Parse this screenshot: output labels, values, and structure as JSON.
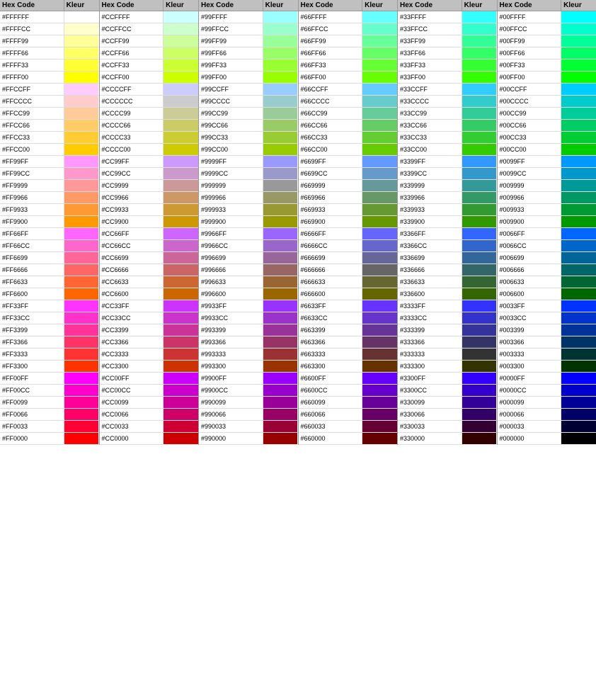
{
  "columns": [
    {
      "id": "col1",
      "header": {
        "hex": "Hex Code",
        "kleur": "Kleur"
      },
      "rows": [
        {
          "hex": "#FFFFFF",
          "color": "#FFFFFF"
        },
        {
          "hex": "#FFFFCC",
          "color": "#FFFFCC"
        },
        {
          "hex": "#FFFF99",
          "color": "#FFFF99"
        },
        {
          "hex": "#FFFF66",
          "color": "#FFFF66"
        },
        {
          "hex": "#FFFF33",
          "color": "#FFFF33"
        },
        {
          "hex": "#FFFF00",
          "color": "#FFFF00"
        },
        {
          "hex": "#FFCCFF",
          "color": "#FFCCFF"
        },
        {
          "hex": "#FFCCCC",
          "color": "#FFCCCC"
        },
        {
          "hex": "#FFCC99",
          "color": "#FFCC99"
        },
        {
          "hex": "#FFCC66",
          "color": "#FFCC66"
        },
        {
          "hex": "#FFCC33",
          "color": "#FFCC33"
        },
        {
          "hex": "#FFCC00",
          "color": "#FFCC00"
        },
        {
          "hex": "#FF99FF",
          "color": "#FF99FF"
        },
        {
          "hex": "#FF99CC",
          "color": "#FF99CC"
        },
        {
          "hex": "#FF9999",
          "color": "#FF9999"
        },
        {
          "hex": "#FF9966",
          "color": "#FF9966"
        },
        {
          "hex": "#FF9933",
          "color": "#FF9933"
        },
        {
          "hex": "#FF9900",
          "color": "#FF9900"
        },
        {
          "hex": "#FF66FF",
          "color": "#FF66FF"
        },
        {
          "hex": "#FF66CC",
          "color": "#FF66CC"
        },
        {
          "hex": "#FF6699",
          "color": "#FF6699"
        },
        {
          "hex": "#FF6666",
          "color": "#FF6666"
        },
        {
          "hex": "#FF6633",
          "color": "#FF6633"
        },
        {
          "hex": "#FF6600",
          "color": "#FF6600"
        },
        {
          "hex": "#FF33FF",
          "color": "#FF33FF"
        },
        {
          "hex": "#FF33CC",
          "color": "#FF33CC"
        },
        {
          "hex": "#FF3399",
          "color": "#FF3399"
        },
        {
          "hex": "#FF3366",
          "color": "#FF3366"
        },
        {
          "hex": "#FF3333",
          "color": "#FF3333"
        },
        {
          "hex": "#FF3300",
          "color": "#FF3300"
        },
        {
          "hex": "#FF00FF",
          "color": "#FF00FF"
        },
        {
          "hex": "#FF00CC",
          "color": "#FF00CC"
        },
        {
          "hex": "#FF0099",
          "color": "#FF0099"
        },
        {
          "hex": "#FF0066",
          "color": "#FF0066"
        },
        {
          "hex": "#FF0033",
          "color": "#FF0033"
        },
        {
          "hex": "#FF0000",
          "color": "#FF0000"
        }
      ]
    },
    {
      "id": "col2",
      "header": {
        "hex": "Hex Code",
        "kleur": "Kleur"
      },
      "rows": [
        {
          "hex": "#CCFFFF",
          "color": "#CCFFFF"
        },
        {
          "hex": "#CCFFCC",
          "color": "#CCFFCC"
        },
        {
          "hex": "#CCFF99",
          "color": "#CCFF99"
        },
        {
          "hex": "#CCFF66",
          "color": "#CCFF66"
        },
        {
          "hex": "#CCFF33",
          "color": "#CCFF33"
        },
        {
          "hex": "#CCFF00",
          "color": "#CCFF00"
        },
        {
          "hex": "#CCCCFF",
          "color": "#CCCCFF"
        },
        {
          "hex": "#CCCCCC",
          "color": "#CCCCCC"
        },
        {
          "hex": "#CCCC99",
          "color": "#CCCC99"
        },
        {
          "hex": "#CCCC66",
          "color": "#CCCC66"
        },
        {
          "hex": "#CCCC33",
          "color": "#CCCC33"
        },
        {
          "hex": "#CCCC00",
          "color": "#CCCC00"
        },
        {
          "hex": "#CC99FF",
          "color": "#CC99FF"
        },
        {
          "hex": "#CC99CC",
          "color": "#CC99CC"
        },
        {
          "hex": "#CC9999",
          "color": "#CC9999"
        },
        {
          "hex": "#CC9966",
          "color": "#CC9966"
        },
        {
          "hex": "#CC9933",
          "color": "#CC9933"
        },
        {
          "hex": "#CC9900",
          "color": "#CC9900"
        },
        {
          "hex": "#CC66FF",
          "color": "#CC66FF"
        },
        {
          "hex": "#CC66CC",
          "color": "#CC66CC"
        },
        {
          "hex": "#CC6699",
          "color": "#CC6699"
        },
        {
          "hex": "#CC6666",
          "color": "#CC6666"
        },
        {
          "hex": "#CC6633",
          "color": "#CC6633"
        },
        {
          "hex": "#CC6600",
          "color": "#CC6600"
        },
        {
          "hex": "#CC33FF",
          "color": "#CC33FF"
        },
        {
          "hex": "#CC33CC",
          "color": "#CC33CC"
        },
        {
          "hex": "#CC3399",
          "color": "#CC3399"
        },
        {
          "hex": "#CC3366",
          "color": "#CC3366"
        },
        {
          "hex": "#CC3333",
          "color": "#CC3333"
        },
        {
          "hex": "#CC3300",
          "color": "#CC3300"
        },
        {
          "hex": "#CC00FF",
          "color": "#CC00FF"
        },
        {
          "hex": "#CC00CC",
          "color": "#CC00CC"
        },
        {
          "hex": "#CC0099",
          "color": "#CC0099"
        },
        {
          "hex": "#CC0066",
          "color": "#CC0066"
        },
        {
          "hex": "#CC0033",
          "color": "#CC0033"
        },
        {
          "hex": "#CC0000",
          "color": "#CC0000"
        }
      ]
    },
    {
      "id": "col3",
      "header": {
        "hex": "Hex Code",
        "kleur": "Kleur"
      },
      "rows": [
        {
          "hex": "#99FFFF",
          "color": "#99FFFF"
        },
        {
          "hex": "#99FFCC",
          "color": "#99FFCC"
        },
        {
          "hex": "#99FF99",
          "color": "#99FF99"
        },
        {
          "hex": "#99FF66",
          "color": "#99FF66"
        },
        {
          "hex": "#99FF33",
          "color": "#99FF33"
        },
        {
          "hex": "#99FF00",
          "color": "#99FF00"
        },
        {
          "hex": "#99CCFF",
          "color": "#99CCFF"
        },
        {
          "hex": "#99CCCC",
          "color": "#99CCCC"
        },
        {
          "hex": "#99CC99",
          "color": "#99CC99"
        },
        {
          "hex": "#99CC66",
          "color": "#99CC66"
        },
        {
          "hex": "#99CC33",
          "color": "#99CC33"
        },
        {
          "hex": "#99CC00",
          "color": "#99CC00"
        },
        {
          "hex": "#9999FF",
          "color": "#9999FF"
        },
        {
          "hex": "#9999CC",
          "color": "#9999CC"
        },
        {
          "hex": "#999999",
          "color": "#999999"
        },
        {
          "hex": "#999966",
          "color": "#999966"
        },
        {
          "hex": "#999933",
          "color": "#999933"
        },
        {
          "hex": "#999900",
          "color": "#999900"
        },
        {
          "hex": "#9966FF",
          "color": "#9966FF"
        },
        {
          "hex": "#9966CC",
          "color": "#9966CC"
        },
        {
          "hex": "#996699",
          "color": "#996699"
        },
        {
          "hex": "#996666",
          "color": "#996666"
        },
        {
          "hex": "#996633",
          "color": "#996633"
        },
        {
          "hex": "#996600",
          "color": "#996600"
        },
        {
          "hex": "#9933FF",
          "color": "#9933FF"
        },
        {
          "hex": "#9933CC",
          "color": "#9933CC"
        },
        {
          "hex": "#993399",
          "color": "#993399"
        },
        {
          "hex": "#993366",
          "color": "#993366"
        },
        {
          "hex": "#993333",
          "color": "#993333"
        },
        {
          "hex": "#993300",
          "color": "#993300"
        },
        {
          "hex": "#9900FF",
          "color": "#9900FF"
        },
        {
          "hex": "#9900CC",
          "color": "#9900CC"
        },
        {
          "hex": "#990099",
          "color": "#990099"
        },
        {
          "hex": "#990066",
          "color": "#990066"
        },
        {
          "hex": "#990033",
          "color": "#990033"
        },
        {
          "hex": "#990000",
          "color": "#990000"
        }
      ]
    },
    {
      "id": "col4",
      "header": {
        "hex": "Hex Code",
        "kleur": "Kleur"
      },
      "rows": [
        {
          "hex": "#66FFFF",
          "color": "#66FFFF"
        },
        {
          "hex": "#66FFCC",
          "color": "#66FFCC"
        },
        {
          "hex": "#66FF99",
          "color": "#66FF99"
        },
        {
          "hex": "#66FF66",
          "color": "#66FF66"
        },
        {
          "hex": "#66FF33",
          "color": "#66FF33"
        },
        {
          "hex": "#66FF00",
          "color": "#66FF00"
        },
        {
          "hex": "#66CCFF",
          "color": "#66CCFF"
        },
        {
          "hex": "#66CCCC",
          "color": "#66CCCC"
        },
        {
          "hex": "#66CC99",
          "color": "#66CC99"
        },
        {
          "hex": "#66CC66",
          "color": "#66CC66"
        },
        {
          "hex": "#66CC33",
          "color": "#66CC33"
        },
        {
          "hex": "#66CC00",
          "color": "#66CC00"
        },
        {
          "hex": "#6699FF",
          "color": "#6699FF"
        },
        {
          "hex": "#6699CC",
          "color": "#6699CC"
        },
        {
          "hex": "#669999",
          "color": "#669999"
        },
        {
          "hex": "#669966",
          "color": "#669966"
        },
        {
          "hex": "#669933",
          "color": "#669933"
        },
        {
          "hex": "#669900",
          "color": "#669900"
        },
        {
          "hex": "#6666FF",
          "color": "#6666FF"
        },
        {
          "hex": "#6666CC",
          "color": "#6666CC"
        },
        {
          "hex": "#666699",
          "color": "#666699"
        },
        {
          "hex": "#666666",
          "color": "#666666"
        },
        {
          "hex": "#666633",
          "color": "#666633"
        },
        {
          "hex": "#666600",
          "color": "#666600"
        },
        {
          "hex": "#6633FF",
          "color": "#6633FF"
        },
        {
          "hex": "#6633CC",
          "color": "#6633CC"
        },
        {
          "hex": "#663399",
          "color": "#663399"
        },
        {
          "hex": "#663366",
          "color": "#663366"
        },
        {
          "hex": "#663333",
          "color": "#663333"
        },
        {
          "hex": "#663300",
          "color": "#663300"
        },
        {
          "hex": "#6600FF",
          "color": "#6600FF"
        },
        {
          "hex": "#6600CC",
          "color": "#6600CC"
        },
        {
          "hex": "#660099",
          "color": "#660099"
        },
        {
          "hex": "#660066",
          "color": "#660066"
        },
        {
          "hex": "#660033",
          "color": "#660033"
        },
        {
          "hex": "#660000",
          "color": "#660000"
        }
      ]
    },
    {
      "id": "col5",
      "header": {
        "hex": "Hex Code",
        "kleur": "Kleur"
      },
      "rows": [
        {
          "hex": "#33FFFF",
          "color": "#33FFFF"
        },
        {
          "hex": "#33FFCC",
          "color": "#33FFCC"
        },
        {
          "hex": "#33FF99",
          "color": "#33FF99"
        },
        {
          "hex": "#33FF66",
          "color": "#33FF66"
        },
        {
          "hex": "#33FF33",
          "color": "#33FF33"
        },
        {
          "hex": "#33FF00",
          "color": "#33FF00"
        },
        {
          "hex": "#33CCFF",
          "color": "#33CCFF"
        },
        {
          "hex": "#33CCCC",
          "color": "#33CCCC"
        },
        {
          "hex": "#33CC99",
          "color": "#33CC99"
        },
        {
          "hex": "#33CC66",
          "color": "#33CC66"
        },
        {
          "hex": "#33CC33",
          "color": "#33CC33"
        },
        {
          "hex": "#33CC00",
          "color": "#33CC00"
        },
        {
          "hex": "#3399FF",
          "color": "#3399FF"
        },
        {
          "hex": "#3399CC",
          "color": "#3399CC"
        },
        {
          "hex": "#339999",
          "color": "#339999"
        },
        {
          "hex": "#339966",
          "color": "#339966"
        },
        {
          "hex": "#339933",
          "color": "#339933"
        },
        {
          "hex": "#339900",
          "color": "#339900"
        },
        {
          "hex": "#3366FF",
          "color": "#3366FF"
        },
        {
          "hex": "#3366CC",
          "color": "#3366CC"
        },
        {
          "hex": "#336699",
          "color": "#336699"
        },
        {
          "hex": "#336666",
          "color": "#336666"
        },
        {
          "hex": "#336633",
          "color": "#336633"
        },
        {
          "hex": "#336600",
          "color": "#336600"
        },
        {
          "hex": "#3333FF",
          "color": "#3333FF"
        },
        {
          "hex": "#3333CC",
          "color": "#3333CC"
        },
        {
          "hex": "#333399",
          "color": "#333399"
        },
        {
          "hex": "#333366",
          "color": "#333366"
        },
        {
          "hex": "#333333",
          "color": "#333333"
        },
        {
          "hex": "#333300",
          "color": "#333300"
        },
        {
          "hex": "#3300FF",
          "color": "#3300FF"
        },
        {
          "hex": "#3300CC",
          "color": "#3300CC"
        },
        {
          "hex": "#330099",
          "color": "#330099"
        },
        {
          "hex": "#330066",
          "color": "#330066"
        },
        {
          "hex": "#330033",
          "color": "#330033"
        },
        {
          "hex": "#330000",
          "color": "#330000"
        }
      ]
    },
    {
      "id": "col6",
      "header": {
        "hex": "Hex Code",
        "kleur": "Kleur"
      },
      "rows": [
        {
          "hex": "#00FFFF",
          "color": "#00FFFF"
        },
        {
          "hex": "#00FFCC",
          "color": "#00FFCC"
        },
        {
          "hex": "#00FF99",
          "color": "#00FF99"
        },
        {
          "hex": "#00FF66",
          "color": "#00FF66"
        },
        {
          "hex": "#00FF33",
          "color": "#00FF33"
        },
        {
          "hex": "#00FF00",
          "color": "#00FF00"
        },
        {
          "hex": "#00CCFF",
          "color": "#00CCFF"
        },
        {
          "hex": "#00CCCC",
          "color": "#00CCCC"
        },
        {
          "hex": "#00CC99",
          "color": "#00CC99"
        },
        {
          "hex": "#00CC66",
          "color": "#00CC66"
        },
        {
          "hex": "#00CC33",
          "color": "#00CC33"
        },
        {
          "hex": "#00CC00",
          "color": "#00CC00"
        },
        {
          "hex": "#0099FF",
          "color": "#0099FF"
        },
        {
          "hex": "#0099CC",
          "color": "#0099CC"
        },
        {
          "hex": "#009999",
          "color": "#009999"
        },
        {
          "hex": "#009966",
          "color": "#009966"
        },
        {
          "hex": "#009933",
          "color": "#009933"
        },
        {
          "hex": "#009900",
          "color": "#009900"
        },
        {
          "hex": "#0066FF",
          "color": "#0066FF"
        },
        {
          "hex": "#0066CC",
          "color": "#0066CC"
        },
        {
          "hex": "#006699",
          "color": "#006699"
        },
        {
          "hex": "#006666",
          "color": "#006666"
        },
        {
          "hex": "#006633",
          "color": "#006633"
        },
        {
          "hex": "#006600",
          "color": "#006600"
        },
        {
          "hex": "#0033FF",
          "color": "#0033FF"
        },
        {
          "hex": "#0033CC",
          "color": "#0033CC"
        },
        {
          "hex": "#003399",
          "color": "#003399"
        },
        {
          "hex": "#003366",
          "color": "#003366"
        },
        {
          "hex": "#003333",
          "color": "#003333"
        },
        {
          "hex": "#003300",
          "color": "#003300"
        },
        {
          "hex": "#0000FF",
          "color": "#0000FF"
        },
        {
          "hex": "#0000CC",
          "color": "#0000CC"
        },
        {
          "hex": "#000099",
          "color": "#000099"
        },
        {
          "hex": "#000066",
          "color": "#000066"
        },
        {
          "hex": "#000033",
          "color": "#000033"
        },
        {
          "hex": "#000000",
          "color": "#000000"
        }
      ]
    }
  ]
}
